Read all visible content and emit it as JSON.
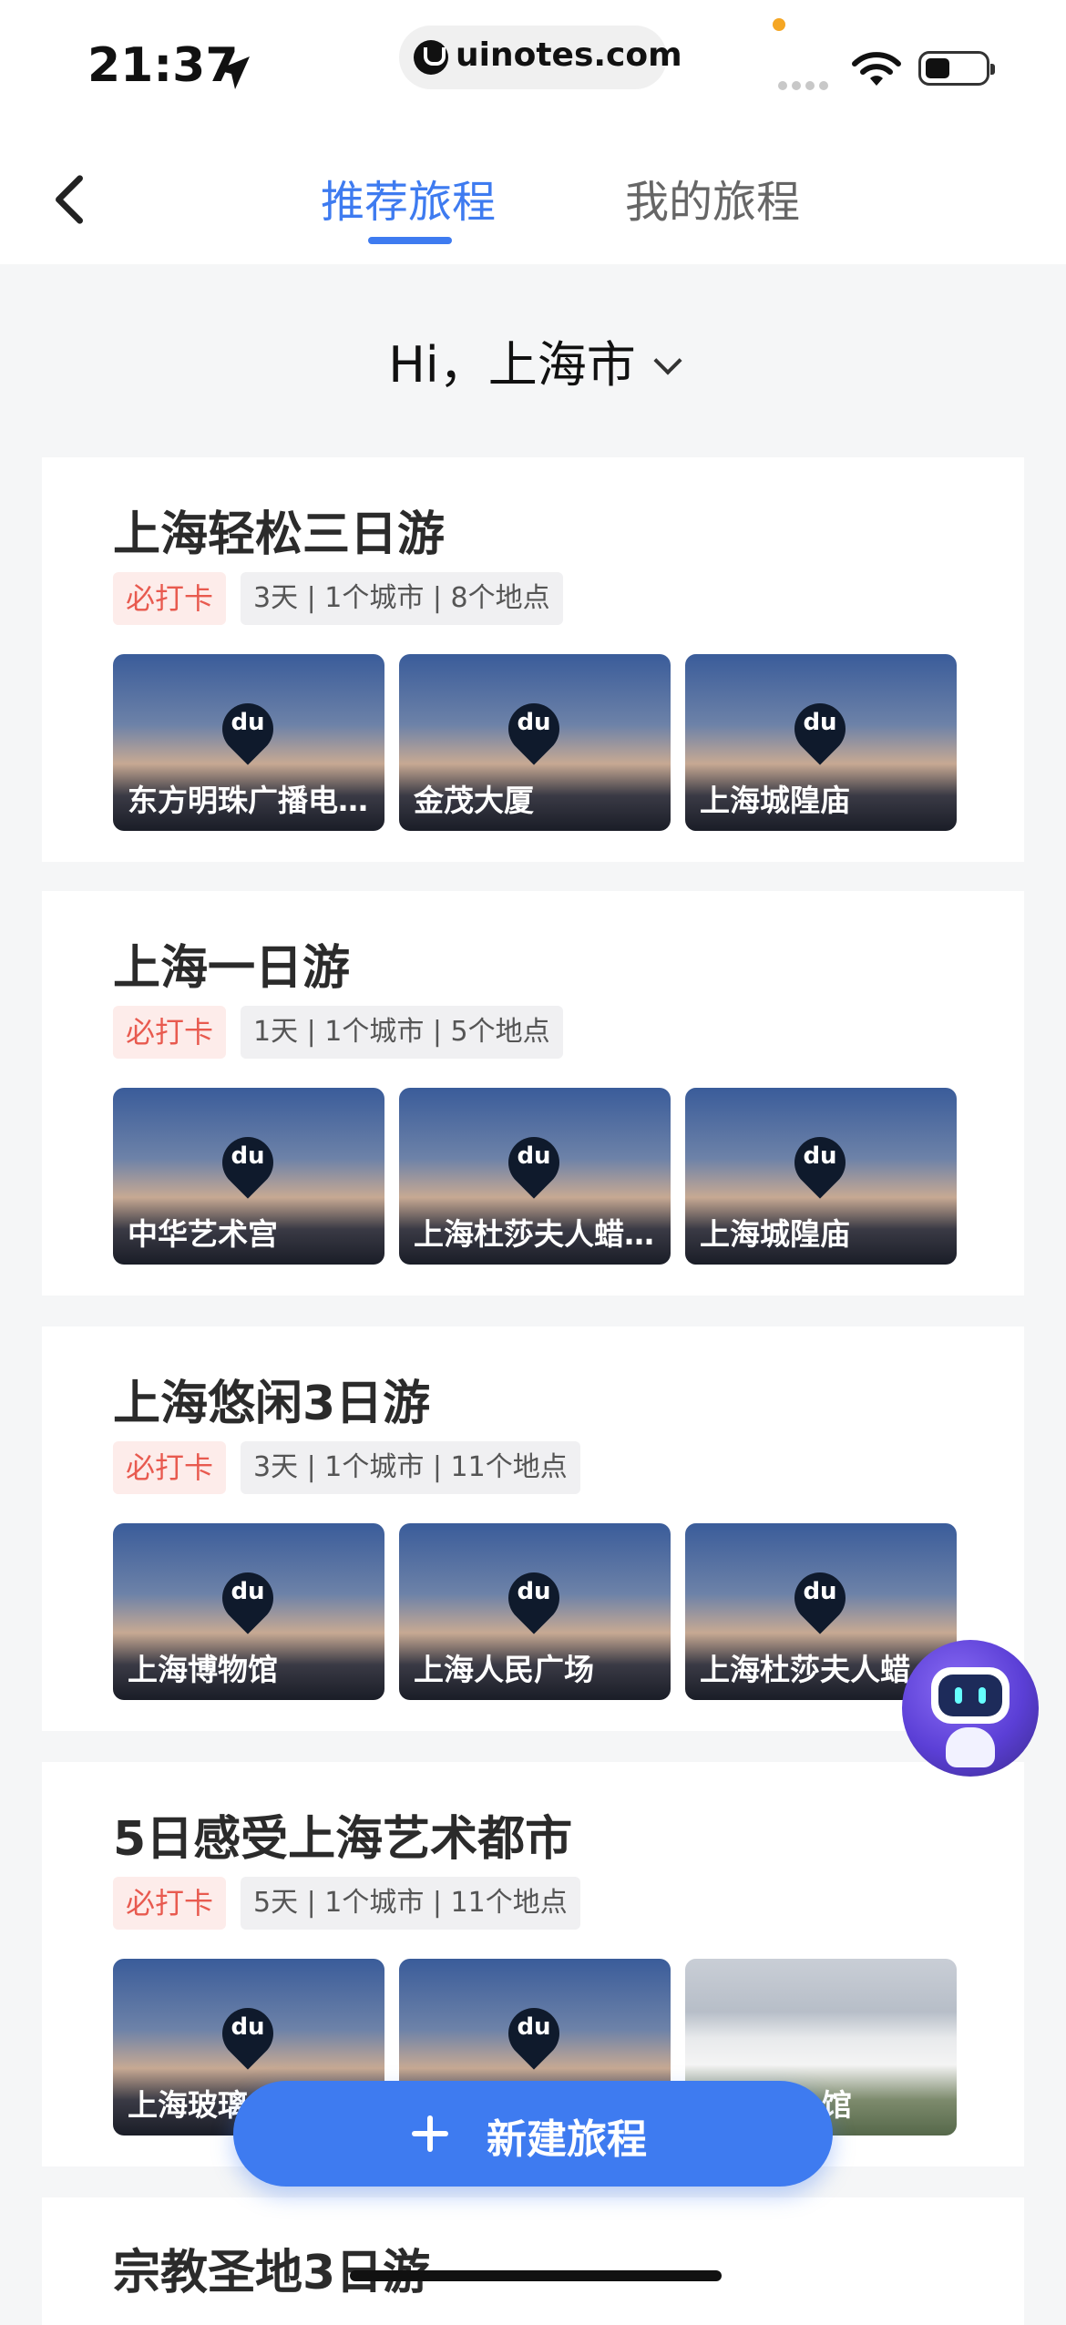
{
  "status_bar": {
    "time": "21:37",
    "url": "uinotes.com"
  },
  "nav": {
    "tab_recommended": "推荐旅程",
    "tab_mine": "我的旅程"
  },
  "greeting": "Hi，上海市",
  "trips": [
    {
      "title": "上海轻松三日游",
      "badge": "必打卡",
      "info": "3天 | 1个城市 | 8个地点",
      "places": [
        "东方明珠广播电…",
        "金茂大厦",
        "上海城隍庙"
      ]
    },
    {
      "title": "上海一日游",
      "badge": "必打卡",
      "info": "1天 | 1个城市 | 5个地点",
      "places": [
        "中华艺术宫",
        "上海杜莎夫人蜡…",
        "上海城隍庙"
      ]
    },
    {
      "title": "上海悠闲3日游",
      "badge": "必打卡",
      "info": "3天 | 1个城市 | 11个地点",
      "places": [
        "上海博物馆",
        "上海人民广场",
        "上海杜莎夫人蜡"
      ]
    },
    {
      "title": "5日感受上海艺术都市",
      "badge": "必打卡",
      "info": "5天 | 1个城市 | 11个地点",
      "places": [
        "上海玻璃",
        "",
        "馆"
      ]
    },
    {
      "title": "宗教圣地3日游"
    }
  ],
  "pin_text": "du",
  "fab_label": "新建旅程",
  "colors": {
    "accent": "#3e7bf0",
    "badge_text": "#e85a4f",
    "badge_bg": "#fdecea"
  },
  "icons": [
    "location-arrow-icon",
    "wifi-icon",
    "battery-icon",
    "back-icon",
    "chevron-down-icon",
    "map-pin-icon",
    "plus-icon",
    "assistant-robot-icon"
  ]
}
